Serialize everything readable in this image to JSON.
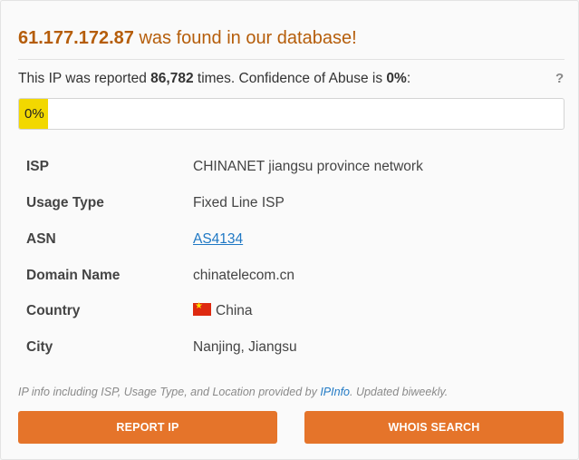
{
  "headline": {
    "ip": "61.177.172.87",
    "suffix": " was found in our database!"
  },
  "report": {
    "prefix": "This IP was reported ",
    "count": "86,782",
    "middle": " times. Confidence of Abuse is ",
    "confidence": "0%",
    "suffix": ":",
    "help_label": "?"
  },
  "progress": {
    "label": "0%",
    "value_percent": 0,
    "fill_color": "#f2d800"
  },
  "details": [
    {
      "label": "ISP",
      "value": "CHINANET jiangsu province network"
    },
    {
      "label": "Usage Type",
      "value": "Fixed Line ISP"
    },
    {
      "label": "ASN",
      "value": "AS4134",
      "link": true
    },
    {
      "label": "Domain Name",
      "value": "chinatelecom.cn"
    },
    {
      "label": "Country",
      "value": "China",
      "flag_icon": "china-flag-icon"
    },
    {
      "label": "City",
      "value": "Nanjing, Jiangsu"
    }
  ],
  "note": {
    "prefix": "IP info including ISP, Usage Type, and Location provided by ",
    "link": "IPInfo",
    "suffix": ". Updated biweekly."
  },
  "buttons": {
    "report_label": "REPORT IP",
    "whois_label": "WHOIS SEARCH",
    "color": "#e5742a"
  },
  "colors": {
    "headline": "#b55d0a",
    "link": "#1f78c4"
  }
}
